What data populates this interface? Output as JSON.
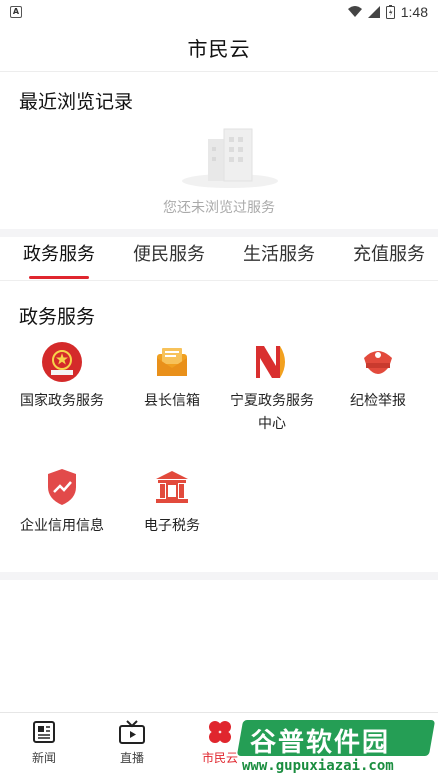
{
  "status_bar": {
    "time": "1:48",
    "notification_icon": "A"
  },
  "header": {
    "title": "市民云"
  },
  "recent": {
    "title": "最近浏览记录",
    "empty_text": "您还未浏览过服务"
  },
  "tabs": [
    {
      "label": "政务服务",
      "active": true
    },
    {
      "label": "便民服务",
      "active": false
    },
    {
      "label": "生活服务",
      "active": false
    },
    {
      "label": "充值服务",
      "active": false
    }
  ],
  "services": {
    "title": "政务服务",
    "items": [
      {
        "label": "国家政务服务",
        "icon": "national-emblem-icon",
        "color": "#d42a2a"
      },
      {
        "label": "县长信箱",
        "icon": "mailbox-icon",
        "color": "#f0a020"
      },
      {
        "label": "宁夏政务服务中心",
        "icon": "ningxia-logo-icon",
        "color": "#d92f2f"
      },
      {
        "label": "纪检举报",
        "icon": "police-cap-icon",
        "color": "#e24a3c"
      },
      {
        "label": "企业信用信息",
        "icon": "shield-trend-icon",
        "color": "#e24a4a"
      },
      {
        "label": "电子税务",
        "icon": "tax-bureau-icon",
        "color": "#e24a3c"
      }
    ]
  },
  "tabbar": [
    {
      "label": "新闻",
      "icon": "news-icon",
      "active": false
    },
    {
      "label": "直播",
      "icon": "tv-icon",
      "active": false
    },
    {
      "label": "市民云",
      "icon": "clover-icon",
      "active": true
    }
  ],
  "watermark": {
    "text": "谷普软件园",
    "url": "www.gupuxiazai.com"
  },
  "colors": {
    "accent": "#e0262e",
    "divider": "#f4f4f6",
    "muted_text": "#aaaaaa"
  }
}
